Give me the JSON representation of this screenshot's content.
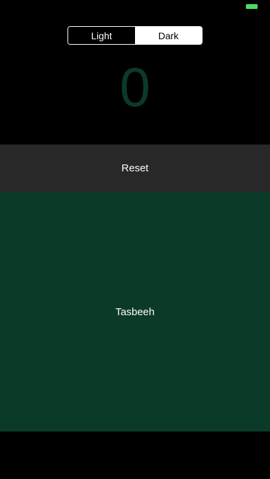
{
  "status_bar": {
    "battery_icon": "battery-icon",
    "battery_color": "#4cd964"
  },
  "theme_toggle": {
    "options": [
      "Light",
      "Dark"
    ],
    "selected": "Dark"
  },
  "counter": {
    "value": "0",
    "color": "#0c3a29"
  },
  "reset": {
    "label": "Reset",
    "background": "#282828"
  },
  "tasbeeh": {
    "label": "Tasbeeh",
    "background": "#0c3a29"
  }
}
